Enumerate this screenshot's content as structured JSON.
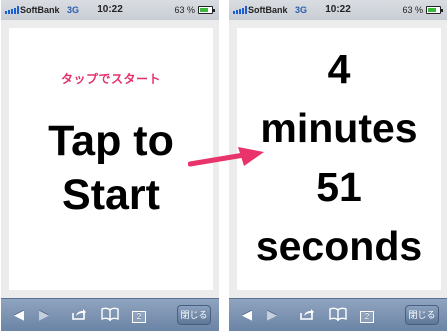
{
  "status": {
    "carrier": "SoftBank",
    "network": "3G",
    "time": "10:22",
    "battery": "63 %"
  },
  "screen_left": {
    "hint": "タップでスタート",
    "line1": "Tap to",
    "line2": "Start"
  },
  "screen_right": {
    "line1": "4",
    "line2": "minutes",
    "line3": "51",
    "line4": "seconds"
  },
  "toolbar": {
    "back_icon": "back-arrow-icon",
    "forward_icon": "forward-arrow-icon",
    "share_icon": "share-icon",
    "bookmarks_icon": "bookmarks-icon",
    "pages_icon": "pages-icon",
    "pages_count": "2",
    "close_label": "閉じる"
  },
  "colors": {
    "hint": "#e7306a",
    "arrow": "#e8336b",
    "toolbar": "#7d93b2",
    "signal": "#1a5fd1",
    "battery": "#3cb83c"
  }
}
